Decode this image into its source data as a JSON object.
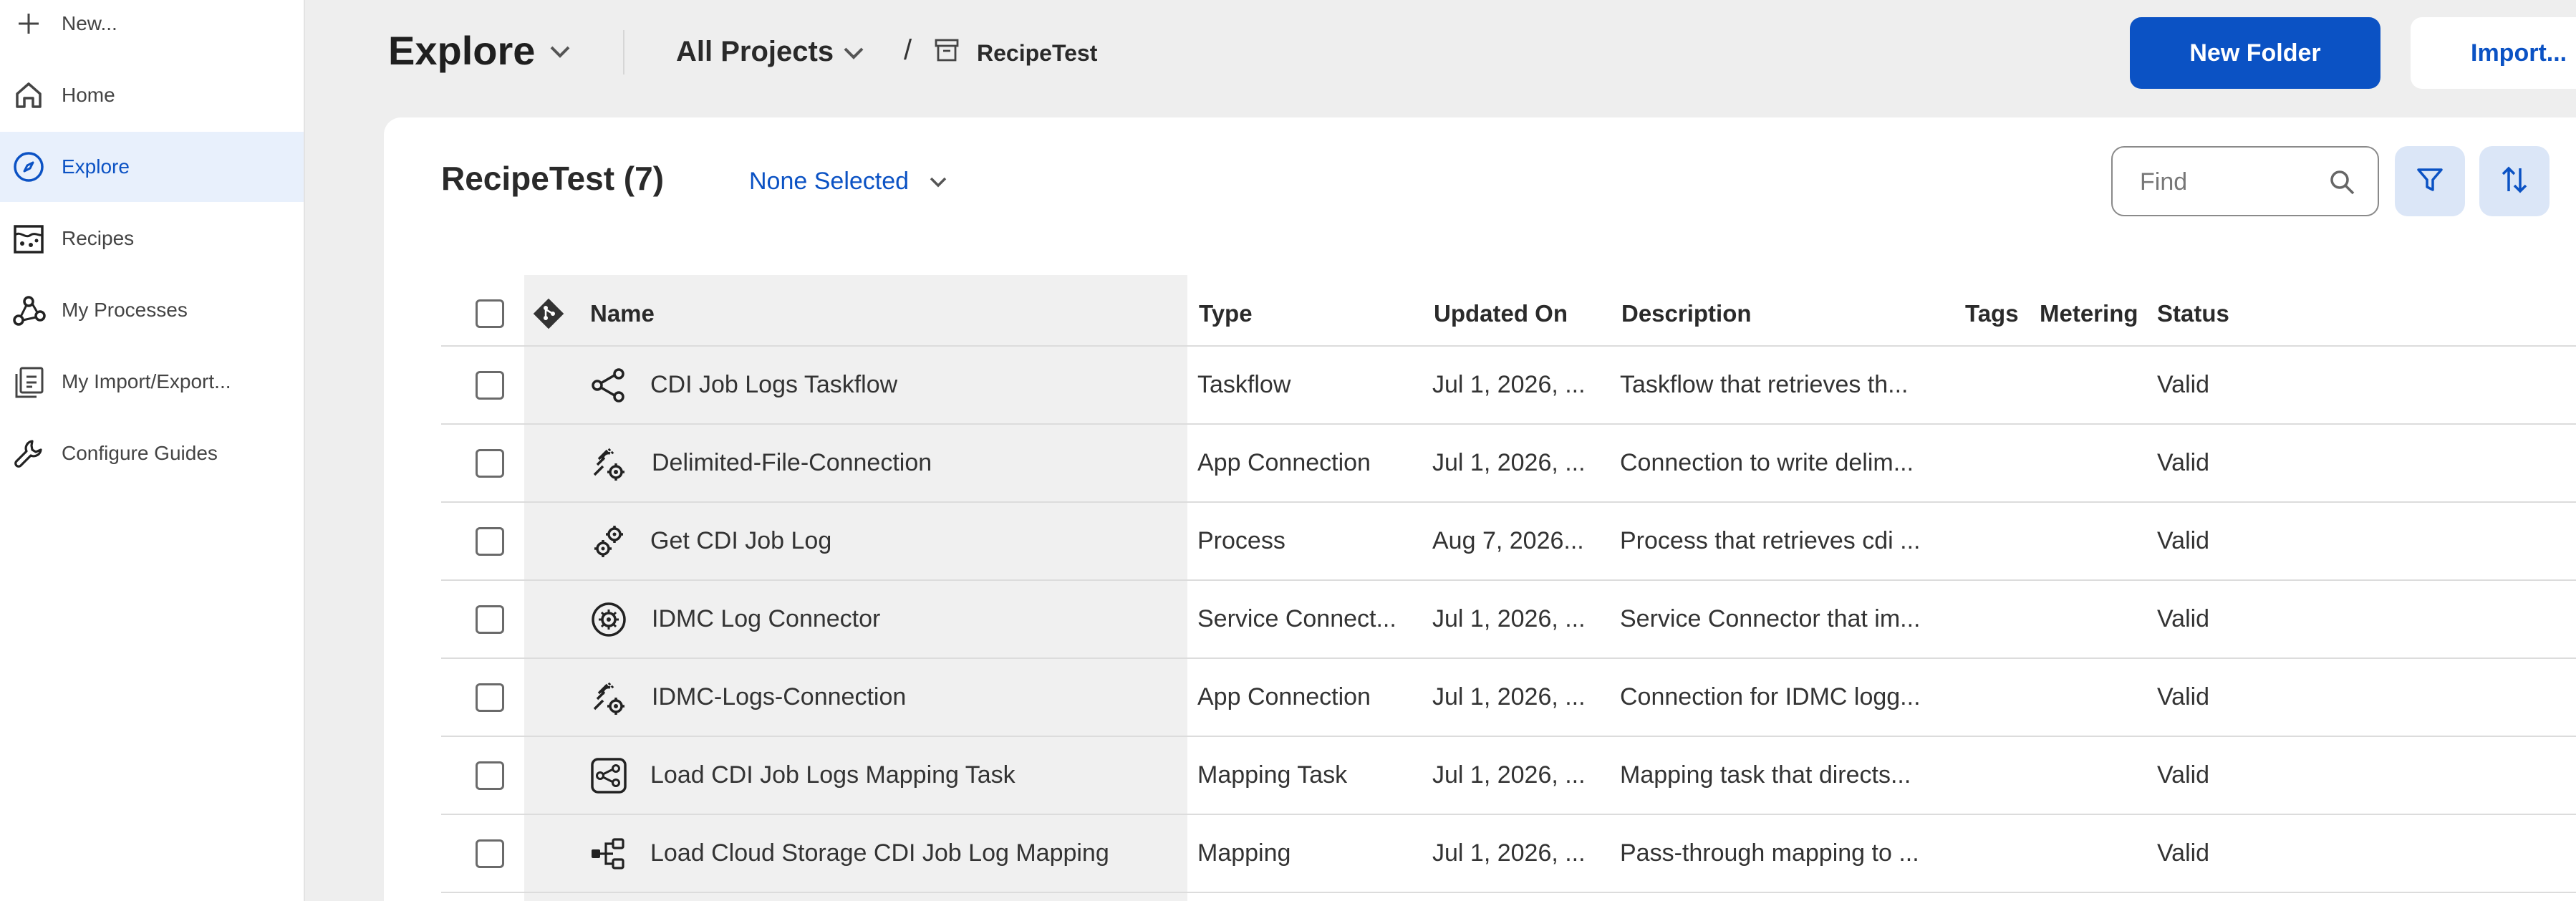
{
  "sidebar": {
    "new_label": "New...",
    "items": [
      {
        "label": "Home",
        "icon": "home-icon"
      },
      {
        "label": "Explore",
        "icon": "compass-icon",
        "active": true
      },
      {
        "label": "Recipes",
        "icon": "recipe-icon"
      },
      {
        "label": "My Processes",
        "icon": "processes-icon"
      },
      {
        "label": "My Import/Export...",
        "icon": "import-export-icon"
      },
      {
        "label": "Configure Guides",
        "icon": "wrench-icon"
      }
    ]
  },
  "header": {
    "title": "Explore",
    "project_selector": "All Projects",
    "breadcrumb_separator": "/",
    "breadcrumb_folder": "RecipeTest",
    "new_folder_label": "New Folder",
    "import_label": "Import..."
  },
  "main": {
    "folder_title": "RecipeTest (7)",
    "selection_label": "None Selected",
    "find_placeholder": "Find"
  },
  "table": {
    "columns": [
      "Name",
      "Type",
      "Updated On",
      "Description",
      "Tags",
      "Metering",
      "Status"
    ],
    "rows": [
      {
        "icon": "taskflow-icon",
        "name": "CDI Job Logs Taskflow",
        "type": "Taskflow",
        "updated": "Jul 1, 2026, ...",
        "description": "Taskflow that retrieves th...",
        "tags": "",
        "metering": "",
        "status": "Valid"
      },
      {
        "icon": "app-connection-icon",
        "name": "Delimited-File-Connection",
        "type": "App Connection",
        "updated": "Jul 1, 2026, ...",
        "description": "Connection to write delim...",
        "tags": "",
        "metering": "",
        "status": "Valid"
      },
      {
        "icon": "process-icon",
        "name": "Get CDI Job Log",
        "type": "Process",
        "updated": "Aug 7, 2026...",
        "description": "Process that retrieves cdi ...",
        "tags": "",
        "metering": "",
        "status": "Valid"
      },
      {
        "icon": "service-connector-icon",
        "name": "IDMC Log Connector",
        "type": "Service Connect...",
        "updated": "Jul 1, 2026, ...",
        "description": "Service Connector that im...",
        "tags": "",
        "metering": "",
        "status": "Valid"
      },
      {
        "icon": "app-connection-icon",
        "name": "IDMC-Logs-Connection",
        "type": "App Connection",
        "updated": "Jul 1, 2026, ...",
        "description": "Connection for IDMC logg...",
        "tags": "",
        "metering": "",
        "status": "Valid"
      },
      {
        "icon": "mapping-task-icon",
        "name": "Load CDI Job Logs Mapping Task",
        "type": "Mapping Task",
        "updated": "Jul 1, 2026, ...",
        "description": "Mapping task that directs...",
        "tags": "",
        "metering": "",
        "status": "Valid"
      },
      {
        "icon": "mapping-icon",
        "name": "Load Cloud Storage CDI Job Log Mapping",
        "type": "Mapping",
        "updated": "Jul 1, 2026, ...",
        "description": "Pass-through mapping to ...",
        "tags": "",
        "metering": "",
        "status": "Valid"
      }
    ]
  },
  "colors": {
    "accent": "#0b52c4",
    "active_nav_bg": "#e8f0fc",
    "icon_button_bg": "#dbe6f7"
  }
}
